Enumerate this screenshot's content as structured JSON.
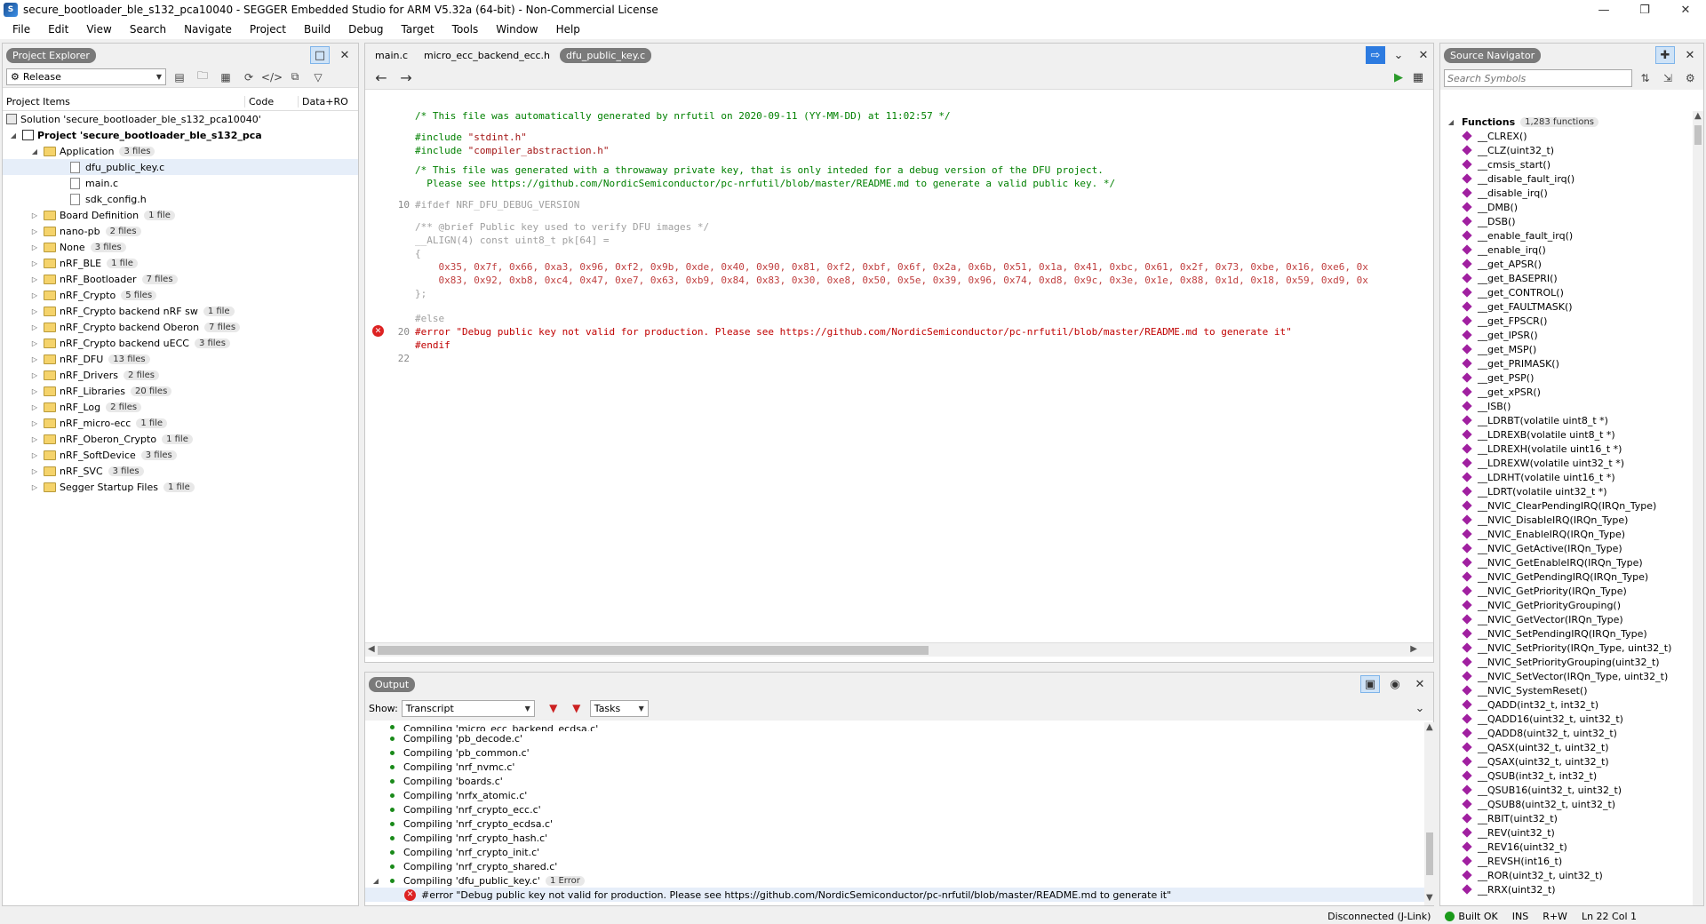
{
  "window": {
    "title": "secure_bootloader_ble_s132_pca10040 - SEGGER Embedded Studio for ARM V5.32a (64-bit) - Non-Commercial License"
  },
  "menu": [
    "File",
    "Edit",
    "View",
    "Search",
    "Navigate",
    "Project",
    "Build",
    "Debug",
    "Target",
    "Tools",
    "Window",
    "Help"
  ],
  "project_explorer": {
    "title": "Project Explorer",
    "config": "Release",
    "columns": {
      "items": "Project Items",
      "code": "Code",
      "data": "Data+RO"
    },
    "solution": "Solution 'secure_bootloader_ble_s132_pca10040'",
    "project": "Project 'secure_bootloader_ble_s132_pca",
    "application": {
      "label": "Application",
      "count": "3 files"
    },
    "app_files": [
      "dfu_public_key.c",
      "main.c",
      "sdk_config.h"
    ],
    "folders": [
      {
        "label": "Board Definition",
        "count": "1 file"
      },
      {
        "label": "nano-pb",
        "count": "2 files"
      },
      {
        "label": "None",
        "count": "3 files"
      },
      {
        "label": "nRF_BLE",
        "count": "1 file"
      },
      {
        "label": "nRF_Bootloader",
        "count": "7 files"
      },
      {
        "label": "nRF_Crypto",
        "count": "5 files"
      },
      {
        "label": "nRF_Crypto backend nRF sw",
        "count": "1 file"
      },
      {
        "label": "nRF_Crypto backend Oberon",
        "count": "7 files"
      },
      {
        "label": "nRF_Crypto backend uECC",
        "count": "3 files"
      },
      {
        "label": "nRF_DFU",
        "count": "13 files"
      },
      {
        "label": "nRF_Drivers",
        "count": "2 files"
      },
      {
        "label": "nRF_Libraries",
        "count": "20 files"
      },
      {
        "label": "nRF_Log",
        "count": "2 files"
      },
      {
        "label": "nRF_micro-ecc",
        "count": "1 file"
      },
      {
        "label": "nRF_Oberon_Crypto",
        "count": "1 file"
      },
      {
        "label": "nRF_SoftDevice",
        "count": "3 files"
      },
      {
        "label": "nRF_SVC",
        "count": "3 files"
      },
      {
        "label": "Segger Startup Files",
        "count": "1 file"
      }
    ]
  },
  "editor": {
    "tabs": [
      "main.c",
      "micro_ecc_backend_ecc.h",
      "dfu_public_key.c"
    ],
    "active_tab": 2,
    "lines": {
      "l1": "/* This file was automatically generated by nrfutil on 2020-09-11 (YY-MM-DD) at 11:02:57 */",
      "inc1a": "#include ",
      "inc1b": "\"stdint.h\"",
      "inc2a": "#include ",
      "inc2b": "\"compiler_abstraction.h\"",
      "c2a": "/* This file was generated with a throwaway private key, that is only inteded for a debug version of the DFU project.",
      "c2b": "  Please see https://github.com/NordicSemiconductor/pc-nrfutil/blob/master/README.md to generate a valid public key. */",
      "ifdef": "#ifdef NRF_DFU_DEBUG_VERSION",
      "brief": "/** @brief Public key used to verify DFU images */",
      "align": "__ALIGN(4) const uint8_t pk[64] =",
      "open": "{",
      "hex1": "    0x35, 0x7f, 0x66, 0xa3, 0x96, 0xf2, 0x9b, 0xde, 0x40, 0x90, 0x81, 0xf2, 0xbf, 0x6f, 0x2a, 0x6b, 0x51, 0x1a, 0x41, 0xbc, 0x61, 0x2f, 0x73, 0xbe, 0x16, 0xe6, 0x",
      "hex2": "    0x83, 0x92, 0xb8, 0xc4, 0x47, 0xe7, 0x63, 0xb9, 0x84, 0x83, 0x30, 0xe8, 0x50, 0x5e, 0x39, 0x96, 0x74, 0xd8, 0x9c, 0x3e, 0x1e, 0x88, 0x1d, 0x18, 0x59, 0xd9, 0x",
      "close": "};",
      "else": "#else",
      "error": "#error \"Debug public key not valid for production. Please see https://github.com/NordicSemiconductor/pc-nrfutil/blob/master/README.md to generate it\"",
      "endif": "#endif"
    },
    "line_numbers": {
      "ifdef": "10",
      "error": "20",
      "last": "22"
    }
  },
  "output": {
    "title": "Output",
    "show_label": "Show:",
    "show_value": "Transcript",
    "tasks_value": "Tasks",
    "partial_line": "Compiling 'micro_ecc_backend_ecdsa.c'",
    "lines": [
      "Compiling 'pb_decode.c'",
      "Compiling 'pb_common.c'",
      "Compiling 'nrf_nvmc.c'",
      "Compiling 'boards.c'",
      "Compiling 'nrfx_atomic.c'",
      "Compiling 'nrf_crypto_ecc.c'",
      "Compiling 'nrf_crypto_ecdsa.c'",
      "Compiling 'nrf_crypto_hash.c'",
      "Compiling 'nrf_crypto_init.c'",
      "Compiling 'nrf_crypto_shared.c'"
    ],
    "last_compile": "Compiling 'dfu_public_key.c'",
    "last_badge": "1 Error",
    "error_line": "#error \"Debug public key not valid for production. Please see https://github.com/NordicSemiconductor/pc-nrfutil/blob/master/README.md to generate it\""
  },
  "navigator": {
    "title": "Source Navigator",
    "search_placeholder": "Search Symbols",
    "section": "Functions",
    "section_count": "1,283 functions",
    "functions": [
      "__CLREX()",
      "__CLZ(uint32_t)",
      "__cmsis_start()",
      "__disable_fault_irq()",
      "__disable_irq()",
      "__DMB()",
      "__DSB()",
      "__enable_fault_irq()",
      "__enable_irq()",
      "__get_APSR()",
      "__get_BASEPRI()",
      "__get_CONTROL()",
      "__get_FAULTMASK()",
      "__get_FPSCR()",
      "__get_IPSR()",
      "__get_MSP()",
      "__get_PRIMASK()",
      "__get_PSP()",
      "__get_xPSR()",
      "__ISB()",
      "__LDRBT(volatile uint8_t *)",
      "__LDREXB(volatile uint8_t *)",
      "__LDREXH(volatile uint16_t *)",
      "__LDREXW(volatile uint32_t *)",
      "__LDRHT(volatile uint16_t *)",
      "__LDRT(volatile uint32_t *)",
      "__NVIC_ClearPendingIRQ(IRQn_Type)",
      "__NVIC_DisableIRQ(IRQn_Type)",
      "__NVIC_EnableIRQ(IRQn_Type)",
      "__NVIC_GetActive(IRQn_Type)",
      "__NVIC_GetEnableIRQ(IRQn_Type)",
      "__NVIC_GetPendingIRQ(IRQn_Type)",
      "__NVIC_GetPriority(IRQn_Type)",
      "__NVIC_GetPriorityGrouping()",
      "__NVIC_GetVector(IRQn_Type)",
      "__NVIC_SetPendingIRQ(IRQn_Type)",
      "__NVIC_SetPriority(IRQn_Type, uint32_t)",
      "__NVIC_SetPriorityGrouping(uint32_t)",
      "__NVIC_SetVector(IRQn_Type, uint32_t)",
      "__NVIC_SystemReset()",
      "__QADD(int32_t, int32_t)",
      "__QADD16(uint32_t, uint32_t)",
      "__QADD8(uint32_t, uint32_t)",
      "__QASX(uint32_t, uint32_t)",
      "__QSAX(uint32_t, uint32_t)",
      "__QSUB(int32_t, int32_t)",
      "__QSUB16(uint32_t, uint32_t)",
      "__QSUB8(uint32_t, uint32_t)",
      "__RBIT(uint32_t)",
      "__REV(uint32_t)",
      "__REV16(uint32_t)",
      "__REVSH(int16_t)",
      "__ROR(uint32_t, uint32_t)",
      "__RRX(uint32_t)"
    ]
  },
  "status": {
    "connection": "Disconnected (J-Link)",
    "build": "Built OK",
    "mode": "INS",
    "rw": "R+W",
    "position": "Ln 22 Col 1"
  }
}
